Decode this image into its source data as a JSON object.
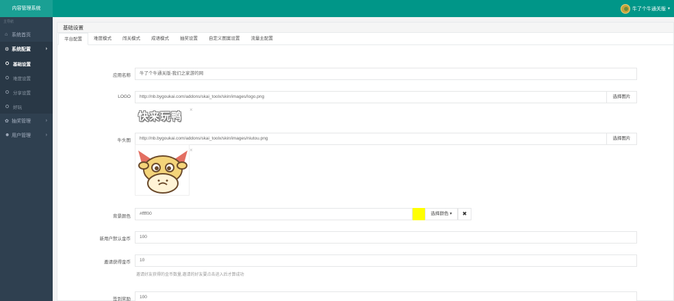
{
  "app": {
    "title": "内容管理系统"
  },
  "user": {
    "name": "牛了个牛通关版",
    "caret": "▾"
  },
  "sidebar": {
    "header": "主导航",
    "items": [
      {
        "label": "系统首页",
        "icon": "home-icon"
      },
      {
        "label": "系统配置",
        "icon": "gear-icon",
        "arrow": "›"
      },
      {
        "label": "基础设置"
      },
      {
        "label": "难度设置"
      },
      {
        "label": "分享设置"
      },
      {
        "label": "好玩"
      },
      {
        "label": "抽奖管理",
        "icon": "gift-icon",
        "arrow": "›"
      },
      {
        "label": "用户管理",
        "icon": "users-icon",
        "arrow": "›"
      }
    ]
  },
  "panel": {
    "title": "基础设置"
  },
  "tabs": [
    "平台配置",
    "难度模式",
    "闯关模式",
    "成语模式",
    "抽奖设置",
    "自定义图案设置",
    "流量主配置"
  ],
  "form": {
    "app_name": {
      "label": "应用名称",
      "value": "牛了个牛通关版-我们之家游的网"
    },
    "logo": {
      "label": "LOGO",
      "value": "http://nb.bygoukai.com/addons/skai_toolx/skin/images/logo.png",
      "button": "选择图片",
      "preview_text": "快来玩鸭",
      "remove": "×"
    },
    "cow_head": {
      "label": "牛头图",
      "value": "http://nb.bygoukai.com/addons/skai_toolx/skin/images/niutou.png",
      "button": "选择图片",
      "remove": "×"
    },
    "bg_color": {
      "label": "背景颜色",
      "value": "#ffff00",
      "swatch_color": "#ffff00",
      "button": "选择颜色 ▾",
      "clear": "✖"
    },
    "new_user_coins": {
      "label": "新用户默认金币",
      "value": "100"
    },
    "invite_coins": {
      "label": "邀请获得金币",
      "value": "10",
      "help": "邀请好友获得的金币数量,邀请的好友要点击进入后才算成功"
    },
    "signin_reward": {
      "label": "签到奖励",
      "value": "100"
    }
  },
  "colors": {
    "topbar": "#009688",
    "sidebar": "#2f4050",
    "accent_yellow": "#ffff00"
  }
}
